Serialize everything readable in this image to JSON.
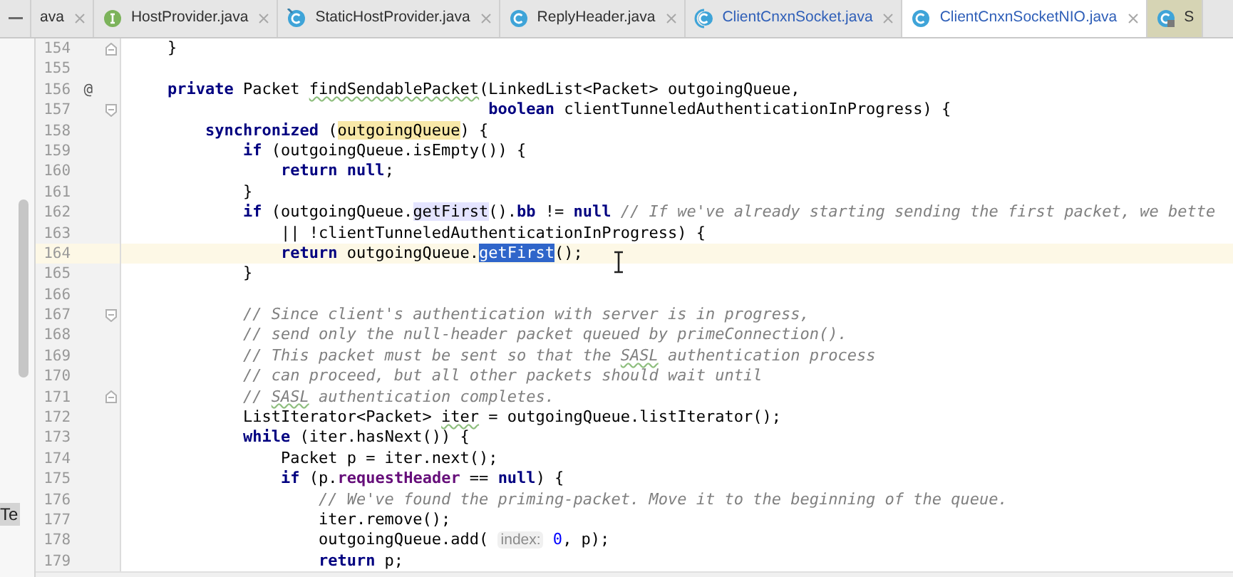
{
  "tabs": [
    {
      "label": "ava",
      "kind": "plain",
      "selected": false,
      "modified": false
    },
    {
      "label": "HostProvider.java",
      "kind": "interface",
      "selected": false,
      "modified": false
    },
    {
      "label": "StaticHostProvider.java",
      "kind": "pinned",
      "selected": false,
      "modified": false
    },
    {
      "label": "ReplyHeader.java",
      "kind": "class",
      "selected": false,
      "modified": false
    },
    {
      "label": "ClientCnxnSocket.java",
      "kind": "abstract",
      "selected": false,
      "modified": true
    },
    {
      "label": "ClientCnxnSocketNIO.java",
      "kind": "class",
      "selected": true,
      "modified": true
    },
    {
      "label": "S",
      "kind": "locked",
      "selected": false,
      "modified": false,
      "color": "#d6d4b4"
    }
  ],
  "tool_strip": {
    "label": "Te"
  },
  "lines": [
    {
      "number": "154",
      "kind": "foldend",
      "current": false,
      "tokens": [
        {
          "text": "    }",
          "kind": "plain"
        }
      ]
    },
    {
      "number": "155",
      "kind": "plain",
      "current": false
    },
    {
      "number": "156",
      "kind": "plain",
      "marker": "@",
      "current": false,
      "tokens": [
        {
          "text": "    private",
          "kind": "keyword"
        },
        {
          "text": " Packet ",
          "kind": "plain"
        },
        {
          "text": "findSendablePacket",
          "kind": "typo"
        },
        {
          "text": "(LinkedList<Packet> outgoingQueue,",
          "kind": "plain"
        }
      ]
    },
    {
      "number": "157",
      "kind": "foldstart",
      "current": false,
      "tokens": [
        {
          "text": "                                      boolean",
          "kind": "keyword"
        },
        {
          "text": " clientTunneledAuthenticationInProgress) {",
          "kind": "plain"
        }
      ]
    },
    {
      "number": "158",
      "kind": "plain",
      "current": false,
      "tokens": [
        {
          "text": "        synchronized",
          "kind": "keyword"
        },
        {
          "text": " (",
          "kind": "plain"
        },
        {
          "text": "outgoingQueue",
          "kind": "match"
        },
        {
          "text": ") {",
          "kind": "plain"
        }
      ]
    },
    {
      "number": "159",
      "kind": "plain",
      "current": false,
      "tokens": [
        {
          "text": "            if",
          "kind": "keyword"
        },
        {
          "text": " (outgoingQueue.isEmpty()) {",
          "kind": "plain"
        }
      ]
    },
    {
      "number": "160",
      "kind": "plain",
      "current": false,
      "tokens": [
        {
          "text": "                return null",
          "kind": "keyword"
        },
        {
          "text": ";",
          "kind": "plain"
        }
      ]
    },
    {
      "number": "161",
      "kind": "plain",
      "current": false,
      "tokens": [
        {
          "text": "            }",
          "kind": "plain"
        }
      ]
    },
    {
      "number": "162",
      "kind": "plain",
      "current": false,
      "tokens": [
        {
          "text": "            if",
          "kind": "keyword"
        },
        {
          "text": " (outgoingQueue.",
          "kind": "plain"
        },
        {
          "text": "getFirst",
          "kind": "usage"
        },
        {
          "text": "().",
          "kind": "plain"
        },
        {
          "text": "bb",
          "kind": "keyword"
        },
        {
          "text": " != ",
          "kind": "plain"
        },
        {
          "text": "null",
          "kind": "keyword"
        },
        {
          "text": " // If we've already starting sending the first packet, we bette",
          "kind": "comment"
        }
      ]
    },
    {
      "number": "163",
      "kind": "plain",
      "current": false,
      "tokens": [
        {
          "text": "                || !clientTunneledAuthenticationInProgress) {",
          "kind": "plain"
        }
      ]
    },
    {
      "number": "164",
      "kind": "plain",
      "current": true,
      "tokens": [
        {
          "text": "                return",
          "kind": "keyword"
        },
        {
          "text": " outgoingQueue.",
          "kind": "plain"
        },
        {
          "text": "getFirst",
          "kind": "selection"
        },
        {
          "text": "();",
          "kind": "plain"
        }
      ]
    },
    {
      "number": "165",
      "kind": "plain",
      "current": false,
      "tokens": [
        {
          "text": "            }",
          "kind": "plain"
        }
      ]
    },
    {
      "number": "166",
      "kind": "plain",
      "current": false
    },
    {
      "number": "167",
      "kind": "foldstart",
      "current": false,
      "tokens": [
        {
          "text": "            // Since client's authentication with server is in progress,",
          "kind": "comment"
        }
      ]
    },
    {
      "number": "168",
      "kind": "plain",
      "current": false,
      "tokens": [
        {
          "text": "            // send only the null-header packet queued by primeConnection().",
          "kind": "comment"
        }
      ]
    },
    {
      "number": "169",
      "kind": "plain",
      "current": false,
      "tokens": [
        {
          "text": "            // This packet must be sent so that the ",
          "kind": "comment"
        },
        {
          "text": "SASL",
          "kind": "commenttypo"
        },
        {
          "text": " authentication process",
          "kind": "comment"
        }
      ]
    },
    {
      "number": "170",
      "kind": "plain",
      "current": false,
      "tokens": [
        {
          "text": "            // can proceed, but all other packets should wait until",
          "kind": "comment"
        }
      ]
    },
    {
      "number": "171",
      "kind": "foldend",
      "current": false,
      "tokens": [
        {
          "text": "            // ",
          "kind": "comment"
        },
        {
          "text": "SASL",
          "kind": "commenttypo"
        },
        {
          "text": " authentication completes.",
          "kind": "comment"
        }
      ]
    },
    {
      "number": "172",
      "kind": "plain",
      "current": false,
      "tokens": [
        {
          "text": "            ListIterator<Packet> ",
          "kind": "plain"
        },
        {
          "text": "iter",
          "kind": "typo"
        },
        {
          "text": " = outgoingQueue.listIterator();",
          "kind": "plain"
        }
      ]
    },
    {
      "number": "173",
      "kind": "plain",
      "current": false,
      "tokens": [
        {
          "text": "            while",
          "kind": "keyword"
        },
        {
          "text": " (iter.hasNext()) {",
          "kind": "plain"
        }
      ]
    },
    {
      "number": "174",
      "kind": "plain",
      "current": false,
      "tokens": [
        {
          "text": "                Packet p = iter.next();",
          "kind": "plain"
        }
      ]
    },
    {
      "number": "175",
      "kind": "plain",
      "current": false,
      "tokens": [
        {
          "text": "                if",
          "kind": "keyword"
        },
        {
          "text": " (p.",
          "kind": "plain"
        },
        {
          "text": "requestHeader",
          "kind": "field"
        },
        {
          "text": " == ",
          "kind": "plain"
        },
        {
          "text": "null",
          "kind": "keyword"
        },
        {
          "text": ") {",
          "kind": "plain"
        }
      ]
    },
    {
      "number": "176",
      "kind": "plain",
      "current": false,
      "tokens": [
        {
          "text": "                    // We've found the priming-packet. Move it to the beginning of the queue.",
          "kind": "comment"
        }
      ]
    },
    {
      "number": "177",
      "kind": "plain",
      "current": false,
      "tokens": [
        {
          "text": "                    iter.remove();",
          "kind": "plain"
        }
      ]
    },
    {
      "number": "178",
      "kind": "plain",
      "current": false,
      "tokens": [
        {
          "text": "                    outgoingQueue.add( ",
          "kind": "plain"
        },
        {
          "text": "index:",
          "kind": "hint"
        },
        {
          "text": " 0",
          "kind": "number"
        },
        {
          "text": ", p);",
          "kind": "plain"
        }
      ]
    },
    {
      "number": "179",
      "kind": "plain",
      "current": false,
      "tokens": [
        {
          "text": "                    return",
          "kind": "keyword"
        },
        {
          "text": " p;",
          "kind": "plain"
        }
      ]
    }
  ]
}
